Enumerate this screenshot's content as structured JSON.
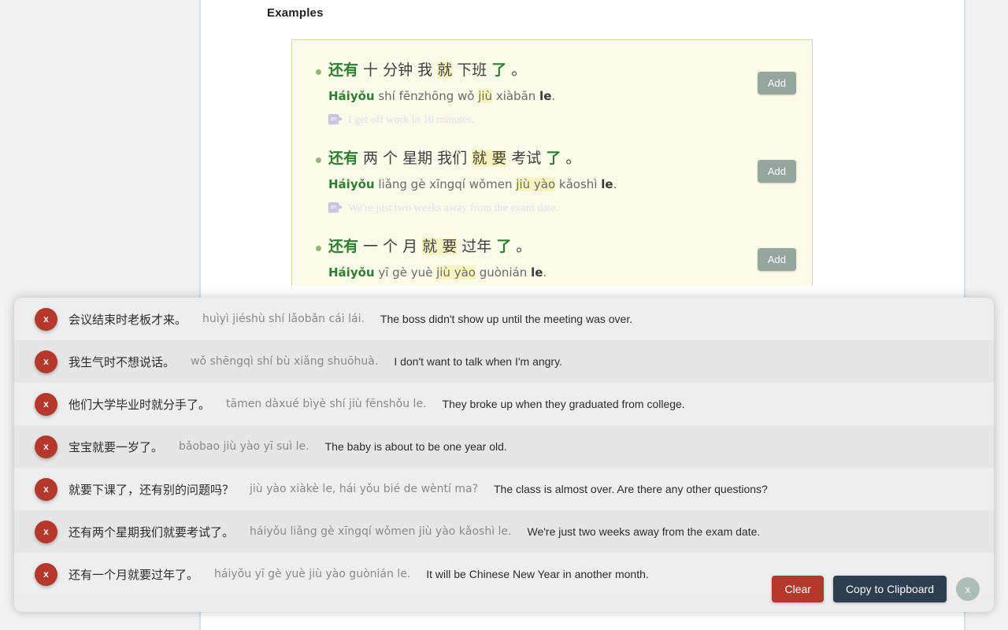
{
  "page": {
    "section_title": "Examples"
  },
  "examples": {
    "add_label": "Add",
    "en_badge_label": "en",
    "items": [
      {
        "hanzi_parts": [
          {
            "t": "还有",
            "kw": true,
            "hl": false
          },
          {
            "t": " 十 分钟 我 ",
            "kw": false,
            "hl": false
          },
          {
            "t": "就",
            "kw": false,
            "hl": true
          },
          {
            "t": " 下班 ",
            "kw": false,
            "hl": false
          },
          {
            "t": "了",
            "kw": true,
            "hl": false
          },
          {
            "t": " 。",
            "kw": false,
            "hl": false
          }
        ],
        "pinyin_parts": [
          {
            "t": "Háiyǒu",
            "kw": true,
            "hl": false,
            "bold": false
          },
          {
            "t": " shí fēnzhōng wǒ ",
            "kw": false,
            "hl": false,
            "bold": false
          },
          {
            "t": "jiù",
            "kw": false,
            "hl": true,
            "bold": false
          },
          {
            "t": " xiàbān ",
            "kw": false,
            "hl": false,
            "bold": false
          },
          {
            "t": "le",
            "kw": false,
            "hl": false,
            "bold": true
          },
          {
            "t": ".",
            "kw": false,
            "hl": false,
            "bold": false
          }
        ],
        "english": "I get off work in 10 minutes."
      },
      {
        "hanzi_parts": [
          {
            "t": "还有",
            "kw": true,
            "hl": false
          },
          {
            "t": " 两 个 星期 我们 ",
            "kw": false,
            "hl": false
          },
          {
            "t": "就 要",
            "kw": false,
            "hl": true
          },
          {
            "t": " 考试 ",
            "kw": false,
            "hl": false
          },
          {
            "t": "了",
            "kw": true,
            "hl": false
          },
          {
            "t": " 。",
            "kw": false,
            "hl": false
          }
        ],
        "pinyin_parts": [
          {
            "t": "Háiyǒu",
            "kw": true,
            "hl": false,
            "bold": false
          },
          {
            "t": " liǎng gè xīngqí wǒmen ",
            "kw": false,
            "hl": false,
            "bold": false
          },
          {
            "t": "jiù yào",
            "kw": false,
            "hl": true,
            "bold": false
          },
          {
            "t": " kǎoshì ",
            "kw": false,
            "hl": false,
            "bold": false
          },
          {
            "t": "le",
            "kw": false,
            "hl": false,
            "bold": true
          },
          {
            "t": ".",
            "kw": false,
            "hl": false,
            "bold": false
          }
        ],
        "english": "We're just two weeks away from the exam date."
      },
      {
        "hanzi_parts": [
          {
            "t": "还有",
            "kw": true,
            "hl": false
          },
          {
            "t": " 一 个 月 ",
            "kw": false,
            "hl": false
          },
          {
            "t": "就 要",
            "kw": false,
            "hl": true
          },
          {
            "t": " 过年 ",
            "kw": false,
            "hl": false
          },
          {
            "t": "了",
            "kw": true,
            "hl": false
          },
          {
            "t": " 。",
            "kw": false,
            "hl": false
          }
        ],
        "pinyin_parts": [
          {
            "t": "Háiyǒu",
            "kw": true,
            "hl": false,
            "bold": false
          },
          {
            "t": " yī gè yuè ",
            "kw": false,
            "hl": false,
            "bold": false
          },
          {
            "t": "jiù yào",
            "kw": false,
            "hl": true,
            "bold": false
          },
          {
            "t": " guònián ",
            "kw": false,
            "hl": false,
            "bold": false
          },
          {
            "t": "le",
            "kw": false,
            "hl": false,
            "bold": true
          },
          {
            "t": ".",
            "kw": false,
            "hl": false,
            "bold": false
          }
        ],
        "english": ""
      }
    ]
  },
  "overlay": {
    "delete_label": "x",
    "close_label": "x",
    "clear_label": "Clear",
    "copy_label": "Copy to Clipboard",
    "sentences": [
      {
        "hanzi": "会议结束时老板才来。",
        "pinyin": "huìyì jiéshù shí lǎobǎn cái lái.",
        "english": "The boss didn't show up until the meeting was over."
      },
      {
        "hanzi": "我生气时不想说话。",
        "pinyin": "wǒ shēngqì shí bù xiǎng shuōhuà.",
        "english": "I don't want to talk when I'm angry."
      },
      {
        "hanzi": "他们大学毕业时就分手了。",
        "pinyin": "tāmen dàxué bìyè shí jiù fēnshǒu le.",
        "english": "They broke up when they graduated from college."
      },
      {
        "hanzi": "宝宝就要一岁了。",
        "pinyin": "bǎobao jiù yào yī suì le.",
        "english": "The baby is about to be one year old."
      },
      {
        "hanzi": "就要下课了，还有别的问题吗？",
        "pinyin": "jiù yào xiàkè le, hái yǒu bié de wèntí ma?",
        "english": "The class is almost over. Are there any other questions?"
      },
      {
        "hanzi": "还有两个星期我们就要考试了。",
        "pinyin": "háiyǒu liǎng gè xīngqí wǒmen jiù yào kǎoshì le.",
        "english": "We're just two weeks away from the exam date."
      },
      {
        "hanzi": "还有一个月就要过年了。",
        "pinyin": "háiyǒu yī gè yuè jiù yào guònián le.",
        "english": "It will be Chinese New Year in another month."
      }
    ]
  },
  "colors": {
    "keyword_green": "#2e7d32",
    "highlight_yellow": "#f7f4c0",
    "danger_red": "#b4382c",
    "navy": "#2c3e50",
    "add_slate": "#94a69e",
    "card_cream": "#fbfbe9"
  }
}
